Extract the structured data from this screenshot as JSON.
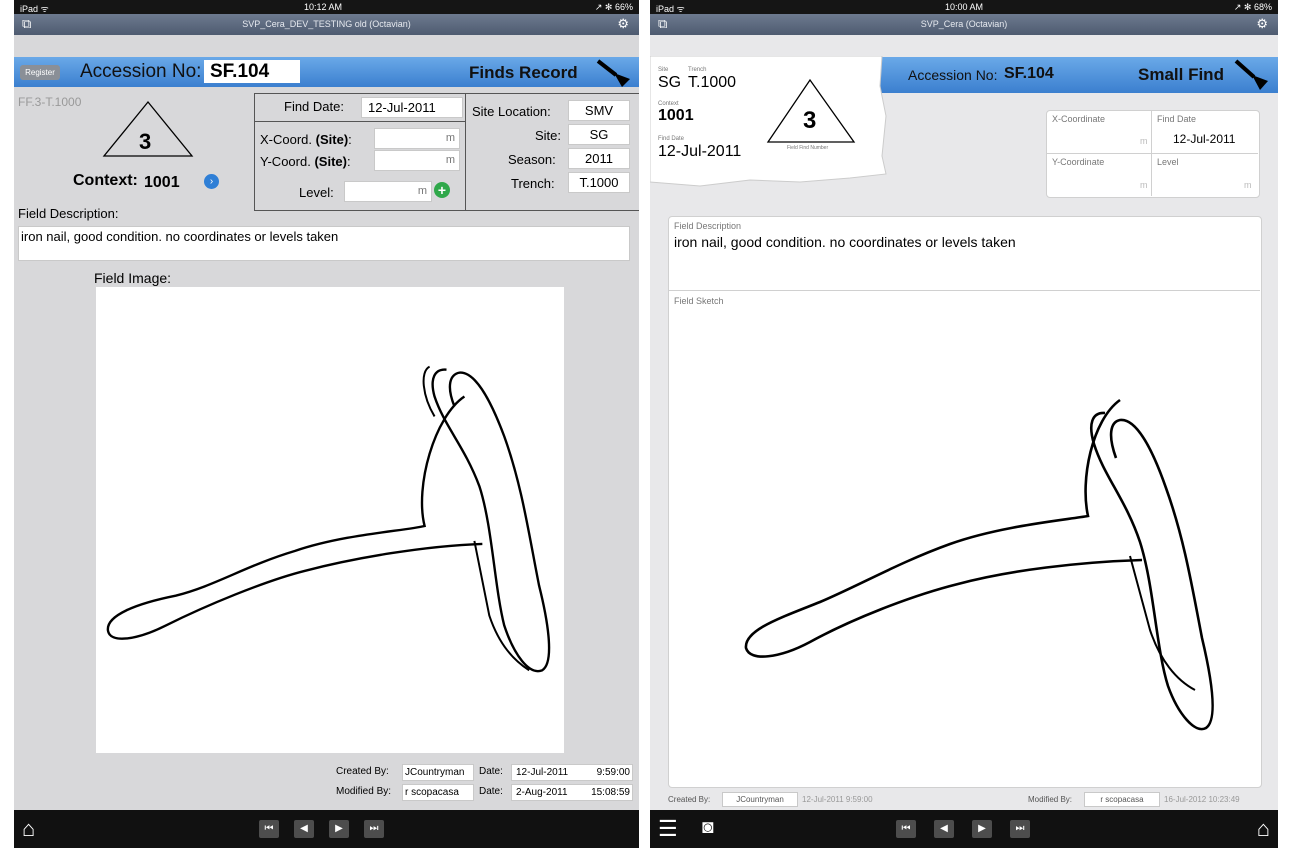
{
  "left": {
    "status": {
      "carrier": "iPad ᯤ",
      "time": "10:12 AM",
      "battery": "↗ ✻ 66%"
    },
    "window_title": "SVP_Cera_DEV_TESTING old (Octavian)",
    "register_btn": "Register",
    "accession_label": "Accession No:",
    "accession_value": "SF.104",
    "record_title": "Finds Record",
    "ff_code": "FF.3-T.1000",
    "field_find_number": "3",
    "context_label": "Context:",
    "context_value": "1001",
    "find_date_label": "Find Date:",
    "find_date_value": "12-Jul-2011",
    "x_coord_label": "X-Coord.",
    "x_coord_site": "(Site)",
    "x_coord_colon": ":",
    "y_coord_label": "Y-Coord.",
    "y_coord_site": "(Site)",
    "y_coord_colon": ":",
    "unit_m": "m",
    "level_label": "Level:",
    "site_location_label": "Site Location:",
    "site_location_value": "SMV",
    "site_label": "Site:",
    "site_value": "SG",
    "season_label": "Season:",
    "season_value": "2011",
    "trench_label": "Trench:",
    "trench_value": "T.1000",
    "field_description_label": "Field Description:",
    "field_description_value": "iron nail, good condition. no coordinates or levels taken",
    "field_image_label": "Field Image:",
    "created_by_label": "Created By:",
    "created_by_value": "JCountryman",
    "created_date_label": "Date:",
    "created_date_value": "12-Jul-2011",
    "created_time_value": "9:59:00",
    "modified_by_label": "Modified By:",
    "modified_by_value": "r scopacasa",
    "modified_date_label": "Date:",
    "modified_date_value": "2-Aug-2011",
    "modified_time_value": "15:08:59"
  },
  "right": {
    "status": {
      "carrier": "iPad ᯤ",
      "time": "10:00 AM",
      "battery": "↗ ✻ 68%"
    },
    "window_title": "SVP_Cera (Octavian)",
    "tag_site_label": "Site",
    "tag_site_value": "SG",
    "tag_trench_label": "Trench",
    "tag_trench_value": "T.1000",
    "tag_context_label": "Context",
    "tag_context_value": "1001",
    "tag_find_date_label": "Find Date",
    "tag_find_date_value": "12-Jul-2011",
    "field_find_number": "3",
    "field_find_number_label": "Field Find Number",
    "accession_label": "Accession No:",
    "accession_value": "SF.104",
    "record_title": "Small Find",
    "x_coord_label": "X-Coordinate",
    "find_date_label": "Find Date",
    "find_date_value": "12-Jul-2011",
    "y_coord_label": "Y-Coordinate",
    "level_label": "Level",
    "unit_m": "m",
    "field_description_label": "Field Description",
    "field_description_value": "iron nail, good condition. no coordinates or levels taken",
    "field_sketch_label": "Field Sketch",
    "created_by_label": "Created By:",
    "created_by_value": "JCountryman",
    "created_stamp": "12-Jul-2011  9:59:00",
    "modified_by_label": "Modified By:",
    "modified_by_value": "r scopacasa",
    "modified_stamp": "16-Jul-2012  10:23:49"
  },
  "colors": {
    "accent_blue": "#3b7fcf",
    "add_green": "#2fa84a",
    "info_blue": "#2f7fd6"
  }
}
